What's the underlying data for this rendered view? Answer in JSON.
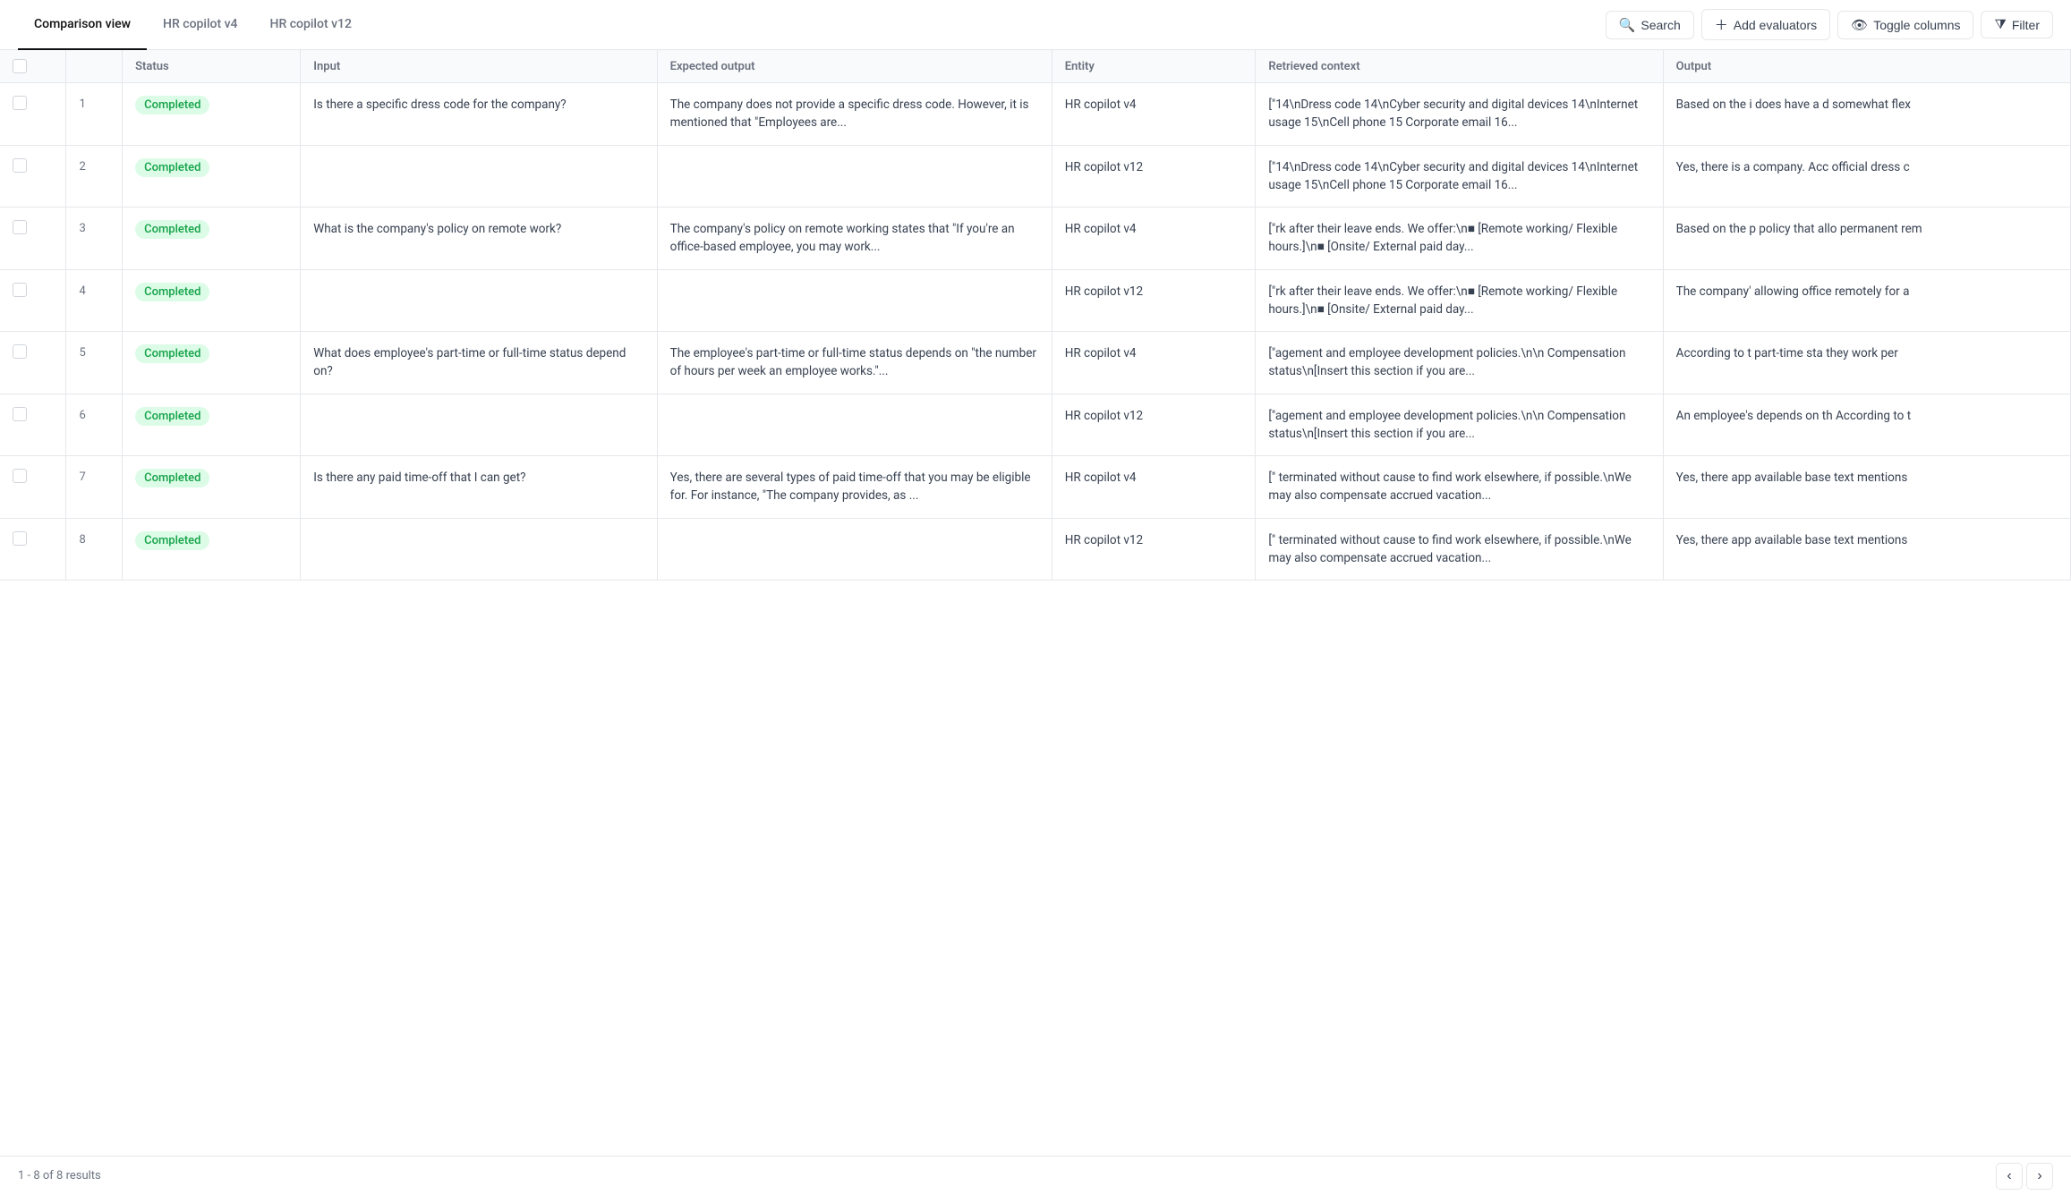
{
  "tabs": [
    {
      "id": "comparison-view",
      "label": "Comparison view",
      "active": true
    },
    {
      "id": "hr-copilot-v4",
      "label": "HR copilot v4",
      "active": false
    },
    {
      "id": "hr-copilot-v12",
      "label": "HR copilot v12",
      "active": false
    }
  ],
  "toolbar": {
    "search_label": "Search",
    "add_evaluators_label": "Add evaluators",
    "toggle_columns_label": "Toggle columns",
    "filter_label": "Filter"
  },
  "table": {
    "columns": [
      {
        "id": "check",
        "label": ""
      },
      {
        "id": "num",
        "label": ""
      },
      {
        "id": "status",
        "label": "Status"
      },
      {
        "id": "input",
        "label": "Input"
      },
      {
        "id": "expected",
        "label": "Expected output"
      },
      {
        "id": "entity",
        "label": "Entity"
      },
      {
        "id": "retrieved",
        "label": "Retrieved context"
      },
      {
        "id": "output",
        "label": "Output"
      }
    ],
    "rows": [
      {
        "num": "1",
        "status": "Completed",
        "input": "Is there a specific dress code for the company?",
        "expected": "The company does not provide a specific dress code. However, it is mentioned that \"Employees are...",
        "entity": "HR copilot v4",
        "retrieved": "[\"14\\nDress code 14\\nCyber security and digital devices 14\\nInternet usage 15\\nCell phone 15 Corporate email 16...",
        "output": "Based on the i does have a d somewhat flex"
      },
      {
        "num": "2",
        "status": "Completed",
        "input": "",
        "expected": "",
        "entity": "HR copilot v12",
        "retrieved": "[\"14\\nDress code 14\\nCyber security and digital devices 14\\nInternet usage 15\\nCell phone 15 Corporate email 16...",
        "output": "Yes, there is a company. Acc official dress c"
      },
      {
        "num": "3",
        "status": "Completed",
        "input": "What is the company's policy on remote work?",
        "expected": "The company's policy on remote working states that \"If you're an office-based employee, you may work...",
        "entity": "HR copilot v4",
        "retrieved": "[\"rk after their leave ends. We offer:\\n■ [Remote working/ Flexible hours.]\\n■ [Onsite/ External paid day...",
        "output": "Based on the p policy that allo permanent rem"
      },
      {
        "num": "4",
        "status": "Completed",
        "input": "",
        "expected": "",
        "entity": "HR copilot v12",
        "retrieved": "[\"rk after their leave ends. We offer:\\n■ [Remote working/ Flexible hours.]\\n■ [Onsite/ External paid day...",
        "output": "The company' allowing office remotely for a"
      },
      {
        "num": "5",
        "status": "Completed",
        "input": "What does employee's part-time or full-time status depend on?",
        "expected": "The employee's part-time or full-time status depends on \"the number of hours per week an employee works.\"...",
        "entity": "HR copilot v4",
        "retrieved": "[\"agement and employee development policies.\\n\\n Compensation status\\n[Insert this section if you are...",
        "output": "According to t part-time sta they work per"
      },
      {
        "num": "6",
        "status": "Completed",
        "input": "",
        "expected": "",
        "entity": "HR copilot v12",
        "retrieved": "[\"agement and employee development policies.\\n\\n Compensation status\\n[Insert this section if you are...",
        "output": "An employee's depends on th According to t"
      },
      {
        "num": "7",
        "status": "Completed",
        "input": "Is there any paid time-off that I can get?",
        "expected": "Yes, there are several types of paid time-off that you may be eligible for. For instance, \"The company provides, as ...",
        "entity": "HR copilot v4",
        "retrieved": "[\" terminated without cause to find work elsewhere, if possible.\\nWe may also compensate accrued vacation...",
        "output": "Yes, there app available base text mentions"
      },
      {
        "num": "8",
        "status": "Completed",
        "input": "",
        "expected": "",
        "entity": "HR copilot v12",
        "retrieved": "[\" terminated without cause to find work elsewhere, if possible.\\nWe may also compensate accrued vacation...",
        "output": "Yes, there app available base text mentions"
      }
    ]
  },
  "footer": {
    "results_label": "1 - 8 of 8 results"
  }
}
